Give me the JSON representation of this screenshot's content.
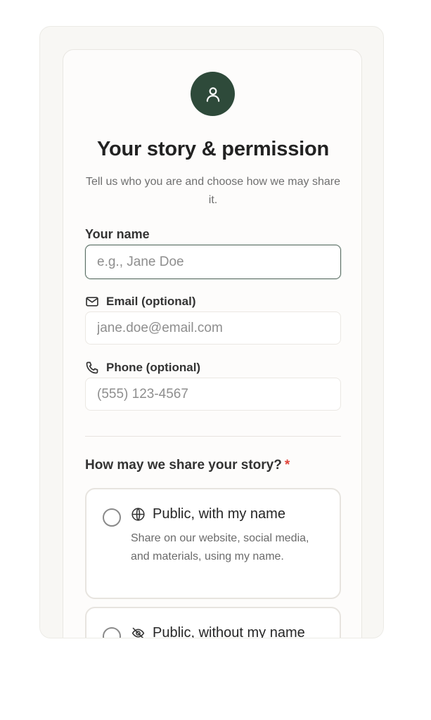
{
  "header": {
    "title": "Your story & permission",
    "subtitle": "Tell us who you are and choose how we may share it."
  },
  "icons": {
    "avatar": "user-icon",
    "email": "mail-icon",
    "phone": "phone-icon",
    "public_named": "globe-icon",
    "public_anonymous": "eye-off-icon"
  },
  "form": {
    "name": {
      "label": "Your name",
      "placeholder": "e.g., Jane Doe",
      "value": ""
    },
    "email": {
      "label": "Email (optional)",
      "placeholder": "jane.doe@email.com",
      "value": ""
    },
    "phone": {
      "label": "Phone (optional)",
      "placeholder": "(555) 123-4567",
      "value": ""
    }
  },
  "sharing": {
    "question": "How may we share your story?",
    "required_marker": "*",
    "options": [
      {
        "title": "Public, with my name",
        "description": "Share on our website, social media, and materials, using my name."
      },
      {
        "title": "Public, without my name",
        "description": ""
      }
    ]
  },
  "colors": {
    "accent": "#2e4a3a",
    "required": "#e0443a"
  }
}
